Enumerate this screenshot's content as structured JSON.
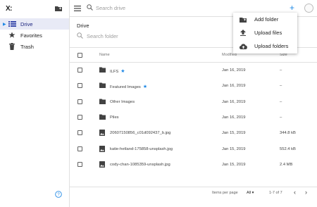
{
  "app": {
    "logo": "X:"
  },
  "sidebar": {
    "items": [
      {
        "label": "Drive",
        "icon": "list-icon",
        "active": true
      },
      {
        "label": "Favorites",
        "icon": "star-icon",
        "active": false
      },
      {
        "label": "Trash",
        "icon": "trash-icon",
        "active": false
      }
    ]
  },
  "topbar": {
    "search_placeholder": "Search drive"
  },
  "main": {
    "breadcrumb": "Drive",
    "folder_search_placeholder": "Search folder",
    "columns": {
      "name": "Name",
      "modified": "Modified",
      "size": "Size"
    }
  },
  "files": [
    {
      "name": "ILFS",
      "type": "folder",
      "starred": true,
      "modified": "Jan 16, 2019",
      "size": "–"
    },
    {
      "name": "Featured Images",
      "type": "folder",
      "starred": true,
      "modified": "Jan 16, 2019",
      "size": "–"
    },
    {
      "name": "Other Images",
      "type": "folder",
      "starred": false,
      "modified": "Jan 16, 2019",
      "size": "–"
    },
    {
      "name": "Piles",
      "type": "folder",
      "starred": false,
      "modified": "Jan 16, 2019",
      "size": "–"
    },
    {
      "name": "20607150856_c01d092437_b.jpg",
      "type": "file",
      "starred": false,
      "modified": "Jan 15, 2019",
      "size": "344.8 kB"
    },
    {
      "name": "katie-hetland-175858-unsplash.jpg",
      "type": "file",
      "starred": false,
      "modified": "Jan 15, 2019",
      "size": "552.4 kB"
    },
    {
      "name": "cody-chan-1085359-unsplash.jpg",
      "type": "file",
      "starred": false,
      "modified": "Jan 15, 2019",
      "size": "2.4 MB"
    }
  ],
  "footer": {
    "items_per_page_label": "Items per page",
    "items_per_page_value": "All",
    "range": "1-7 of 7"
  },
  "add_menu": {
    "items": [
      {
        "label": "Add folder",
        "icon": "create-folder-icon"
      },
      {
        "label": "Upload files",
        "icon": "upload-icon"
      },
      {
        "label": "Upload folders",
        "icon": "cloud-upload-icon"
      }
    ]
  },
  "colors": {
    "accent": "#1e88e5",
    "active_bg": "#e8eaf6",
    "divider": "#e0e0e0"
  }
}
